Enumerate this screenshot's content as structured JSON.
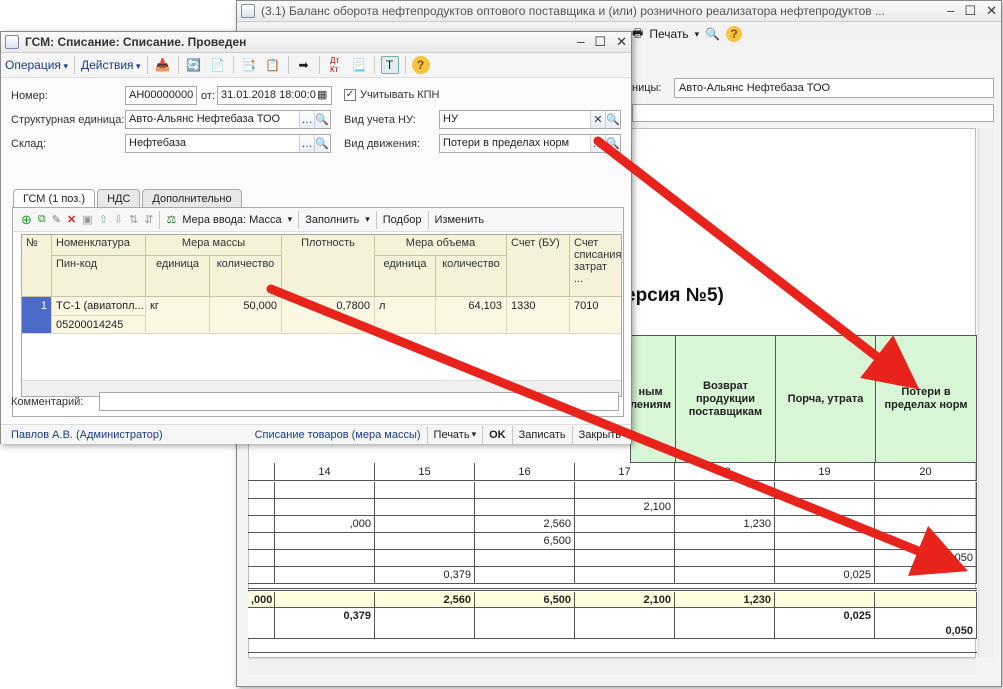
{
  "back_window": {
    "title": "(3.1) Баланс оборота нефтепродуктов оптового поставщика и (или) розничного реализатора нефтепродуктов ...",
    "print_label": "Печать",
    "org_label": "ницы:",
    "org_value": "Авто-Альянс Нефтебаза ТОО",
    "report_title_fragment": "ерсия №5)",
    "headers": {
      "col_partial": "ным\nлениям",
      "col_return": "Возврат продукции поставщикам",
      "col_spoil": "Порча, утрата",
      "col_losses": "Потери в пределах норм"
    },
    "col_numbers": [
      "14",
      "15",
      "16",
      "17",
      "18",
      "19",
      "20"
    ],
    "rows": [
      [
        "",
        "",
        "",
        "",
        "",
        "",
        ""
      ],
      [
        "",
        "",
        "",
        "2,100",
        "",
        "",
        ""
      ],
      [
        ",000",
        "",
        "2,560",
        "",
        "1,230",
        "",
        ""
      ],
      [
        "",
        "",
        "6,500",
        "",
        "",
        "",
        ""
      ],
      [
        "",
        "",
        "",
        "",
        "",
        "",
        "0,050"
      ],
      [
        "",
        "0,379",
        "",
        "",
        "",
        "0,025",
        ""
      ]
    ],
    "totals": [
      [
        ",000",
        "",
        "2,560",
        "6,500",
        "2,100",
        "1,230",
        "",
        ""
      ],
      [
        "",
        "0,379",
        "",
        "",
        "",
        "",
        "0,025",
        ""
      ],
      [
        "",
        "",
        "",
        "",
        "",
        "",
        "",
        "0,050"
      ]
    ]
  },
  "front_window": {
    "title": "ГСМ: Списание: Списание. Проведен",
    "menu": {
      "operation": "Операция",
      "actions": "Действия"
    },
    "fields": {
      "number_label": "Номер:",
      "number_value": "АН00000000",
      "from_label": "от:",
      "date_value": "31.01.2018 18:00:0",
      "kpn_label": "Учитывать КПН",
      "unit_label": "Структурная единица:",
      "unit_value": "Авто-Альянс Нефтебаза ТОО",
      "nu_label": "Вид учета НУ:",
      "nu_value": "НУ",
      "warehouse_label": "Склад:",
      "warehouse_value": "Нефтебаза",
      "movement_label": "Вид движения:",
      "movement_value": "Потери в пределах норм",
      "comment_label": "Комментарий:"
    },
    "tabs": [
      "ГСМ (1 поз.)",
      "НДС",
      "Дополнительно"
    ],
    "subtoolbar": {
      "measure": "Мера ввода: Масса",
      "fill": "Заполнить",
      "select": "Подбор",
      "change": "Изменить"
    },
    "grid_headers": {
      "num": "№",
      "nomenclature": "Номенклатура",
      "pin": "Пин-код",
      "mass": "Мера массы",
      "mass_unit": "единица",
      "mass_qty": "количество",
      "density": "Плотность",
      "volume": "Мера объема",
      "vol_unit": "единица",
      "vol_qty": "количество",
      "account_bu": "Счет (БУ)",
      "account_write": "Счет списания затрат ..."
    },
    "grid_row": {
      "num": "1",
      "nomenclature": "ТС-1 (авиатопл...",
      "pin": "05200014245",
      "mass_unit": "кг",
      "mass_qty": "50,000",
      "density": "0,7800",
      "vol_unit": "л",
      "vol_qty": "64,103",
      "account_bu": "1330",
      "account_write": "7010"
    },
    "footer": {
      "user": "Павлов А.В. (Администратор)",
      "doc_print": "Списание товаров (мера массы)",
      "print": "Печать",
      "ok": "OK",
      "save": "Записать",
      "close": "Закрыть"
    }
  },
  "colors": {
    "accent_green": "#d8f5d5",
    "arrow_red": "#e8231b",
    "grid_header": "#f6f2d9"
  }
}
